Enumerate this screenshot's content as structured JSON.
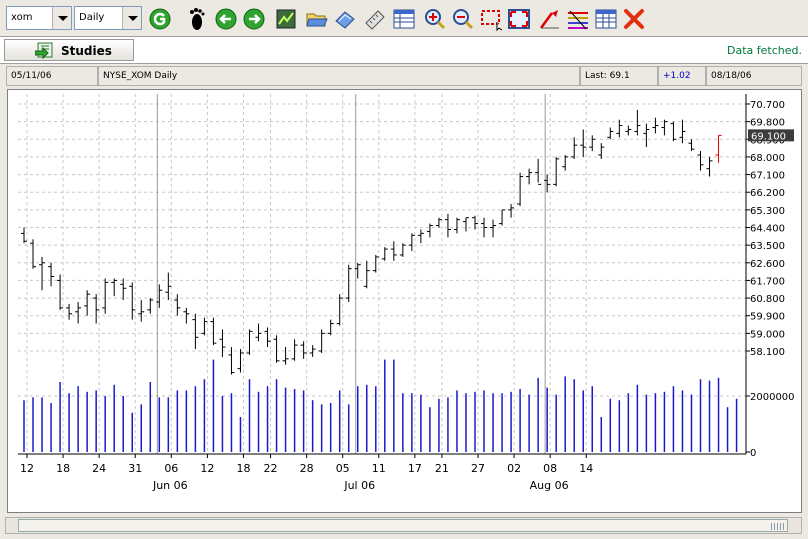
{
  "toolbar": {
    "symbol_value": "xom",
    "period_value": "Daily",
    "buttons": [
      {
        "name": "go-icon"
      },
      {
        "name": "footprint-icon"
      },
      {
        "name": "back-icon"
      },
      {
        "name": "forward-icon"
      },
      {
        "name": "chart-icon"
      },
      {
        "name": "open-folder-icon"
      },
      {
        "name": "eraser-icon"
      },
      {
        "name": "ruler-icon"
      },
      {
        "name": "table-icon"
      },
      {
        "name": "zoom-in-icon"
      },
      {
        "name": "zoom-out-icon"
      },
      {
        "name": "select-region-icon"
      },
      {
        "name": "fit-icon"
      },
      {
        "name": "draw-line-icon"
      },
      {
        "name": "fibonacci-icon"
      },
      {
        "name": "grid-icon"
      },
      {
        "name": "delete-icon"
      }
    ]
  },
  "status": {
    "studies_label": "Studies",
    "message": "Data fetched."
  },
  "info": {
    "start_date": "05/11/06",
    "title": "NYSE_XOM Daily",
    "last": "Last: 69.1",
    "change": "+1.02",
    "end_date": "08/18/06"
  },
  "colors": {
    "change": "#0000c8",
    "price_bar": "#000000",
    "last_bar": "#e00000",
    "volume": "#1a1acc",
    "message": "#007a3d"
  },
  "chart_data": {
    "type": "ohlc",
    "y_ticks": [
      "70.700",
      "69.800",
      "68.900",
      "68.000",
      "67.100",
      "66.200",
      "65.300",
      "64.400",
      "63.500",
      "62.600",
      "61.700",
      "60.800",
      "59.900",
      "59.000",
      "58.100"
    ],
    "last_label": "69.100",
    "volume_ticks": [
      "2000000",
      "0"
    ],
    "x_day_labels": [
      "12",
      "18",
      "24",
      "31",
      "06",
      "12",
      "18",
      "22",
      "28",
      "05",
      "11",
      "17",
      "21",
      "27",
      "02",
      "08",
      "14"
    ],
    "x_month_labels": [
      "Jun 06",
      "Jul 06",
      "Aug 06"
    ],
    "ohlc": [
      [
        64.1,
        64.4,
        63.6,
        63.7
      ],
      [
        63.6,
        63.8,
        62.3,
        62.4
      ],
      [
        62.5,
        62.9,
        61.2,
        62.6
      ],
      [
        62.4,
        62.6,
        61.4,
        61.9
      ],
      [
        61.7,
        62.0,
        60.2,
        60.3
      ],
      [
        60.3,
        60.5,
        59.7,
        60.0
      ],
      [
        60.1,
        60.6,
        59.5,
        60.3
      ],
      [
        60.4,
        61.2,
        59.9,
        61.0
      ],
      [
        60.8,
        61.0,
        59.5,
        60.2
      ],
      [
        60.3,
        61.8,
        60.0,
        61.6
      ],
      [
        61.6,
        61.8,
        60.9,
        61.7
      ],
      [
        61.5,
        61.8,
        60.7,
        61.3
      ],
      [
        61.4,
        61.6,
        59.7,
        60.2
      ],
      [
        60.0,
        60.7,
        59.6,
        60.1
      ],
      [
        60.2,
        60.8,
        60.0,
        60.7
      ],
      [
        60.6,
        61.5,
        60.3,
        61.2
      ],
      [
        61.1,
        62.1,
        60.7,
        61.4
      ],
      [
        60.7,
        61.0,
        59.9,
        60.3
      ],
      [
        60.1,
        60.3,
        59.5,
        60.0
      ],
      [
        59.7,
        60.0,
        58.2,
        58.8
      ],
      [
        59.0,
        59.8,
        58.9,
        59.6
      ],
      [
        59.6,
        59.8,
        58.4,
        58.5
      ],
      [
        58.7,
        59.2,
        57.8,
        58.3
      ],
      [
        57.9,
        58.3,
        56.9,
        57.0
      ],
      [
        57.2,
        58.2,
        57.0,
        58.0
      ],
      [
        58.0,
        59.2,
        57.9,
        59.1
      ],
      [
        58.8,
        59.5,
        58.6,
        59.0
      ],
      [
        59.1,
        59.3,
        58.3,
        58.6
      ],
      [
        58.7,
        58.9,
        57.5,
        57.6
      ],
      [
        57.6,
        58.3,
        57.4,
        57.7
      ],
      [
        57.7,
        58.7,
        57.6,
        58.4
      ],
      [
        58.4,
        58.6,
        57.7,
        58.0
      ],
      [
        58.0,
        58.4,
        57.8,
        58.2
      ],
      [
        58.1,
        59.2,
        58.0,
        59.0
      ],
      [
        59.0,
        59.7,
        58.9,
        59.5
      ],
      [
        59.5,
        61.0,
        59.4,
        60.8
      ],
      [
        60.8,
        62.5,
        60.6,
        62.3
      ],
      [
        62.3,
        62.6,
        61.8,
        62.5
      ],
      [
        61.4,
        62.7,
        61.3,
        62.2
      ],
      [
        62.2,
        63.0,
        62.1,
        62.9
      ],
      [
        62.8,
        63.4,
        62.7,
        63.3
      ],
      [
        63.3,
        63.7,
        62.7,
        63.0
      ],
      [
        63.0,
        63.6,
        62.9,
        63.5
      ],
      [
        63.5,
        64.1,
        63.2,
        64.0
      ],
      [
        64.0,
        64.3,
        63.6,
        64.1
      ],
      [
        64.2,
        64.6,
        63.9,
        64.5
      ],
      [
        64.5,
        64.9,
        64.4,
        64.8
      ],
      [
        64.8,
        65.1,
        63.9,
        64.3
      ],
      [
        64.3,
        64.9,
        64.1,
        64.8
      ],
      [
        64.7,
        64.9,
        64.2,
        64.9
      ],
      [
        64.9,
        65.0,
        64.3,
        64.6
      ],
      [
        64.6,
        64.9,
        63.9,
        64.4
      ],
      [
        64.4,
        64.8,
        63.9,
        64.5
      ],
      [
        64.6,
        65.3,
        64.5,
        65.3
      ],
      [
        65.3,
        65.6,
        64.9,
        65.4
      ],
      [
        65.6,
        67.2,
        65.5,
        67.0
      ],
      [
        67.0,
        67.4,
        66.6,
        67.2
      ],
      [
        67.2,
        67.9,
        66.7,
        66.6
      ],
      [
        66.8,
        67.1,
        66.2,
        66.6
      ],
      [
        66.6,
        68.0,
        66.5,
        67.9
      ],
      [
        67.5,
        68.1,
        67.3,
        68.0
      ],
      [
        68.0,
        69.0,
        67.9,
        68.6
      ],
      [
        68.6,
        69.4,
        68.0,
        68.5
      ],
      [
        68.5,
        69.1,
        68.3,
        68.9
      ],
      [
        68.1,
        68.7,
        67.9,
        68.5
      ],
      [
        69.0,
        69.5,
        68.9,
        69.3
      ],
      [
        69.2,
        69.9,
        69.0,
        69.6
      ],
      [
        69.3,
        69.6,
        69.1,
        69.4
      ],
      [
        69.3,
        70.4,
        69.1,
        69.6
      ],
      [
        69.2,
        69.7,
        68.5,
        69.4
      ],
      [
        69.5,
        70.0,
        69.2,
        69.6
      ],
      [
        69.5,
        69.9,
        69.1,
        69.8
      ],
      [
        69.7,
        69.8,
        68.8,
        68.9
      ],
      [
        69.0,
        69.9,
        68.7,
        69.3
      ],
      [
        68.7,
        68.9,
        68.3,
        68.4
      ],
      [
        68.1,
        68.3,
        67.3,
        67.6
      ],
      [
        67.4,
        68.0,
        67.0,
        67.8
      ],
      [
        68.1,
        69.1,
        67.7,
        69.1
      ]
    ],
    "volume": [
      1850000,
      1950000,
      1950000,
      1750000,
      2500000,
      2100000,
      2350000,
      2150000,
      2200000,
      2000000,
      2400000,
      2000000,
      1400000,
      1700000,
      2500000,
      1950000,
      1950000,
      2200000,
      2200000,
      2350000,
      2600000,
      3300000,
      2000000,
      2100000,
      1250000,
      2600000,
      2150000,
      2350000,
      2600000,
      2300000,
      2250000,
      2200000,
      1850000,
      1700000,
      1750000,
      2200000,
      1700000,
      2350000,
      2400000,
      2350000,
      3300000,
      3300000,
      2100000,
      2100000,
      2050000,
      1600000,
      1900000,
      1950000,
      2200000,
      2100000,
      2150000,
      2200000,
      2100000,
      2100000,
      2150000,
      2250000,
      2050000,
      2650000,
      2300000,
      2050000,
      2700000,
      2600000,
      2200000,
      2350000,
      1250000,
      1900000,
      1850000,
      2100000,
      2400000,
      2050000,
      2100000,
      2150000,
      2350000,
      2200000,
      2050000,
      2600000,
      2550000,
      2650000,
      1600000,
      1900000
    ],
    "volume_max": 4000000
  }
}
